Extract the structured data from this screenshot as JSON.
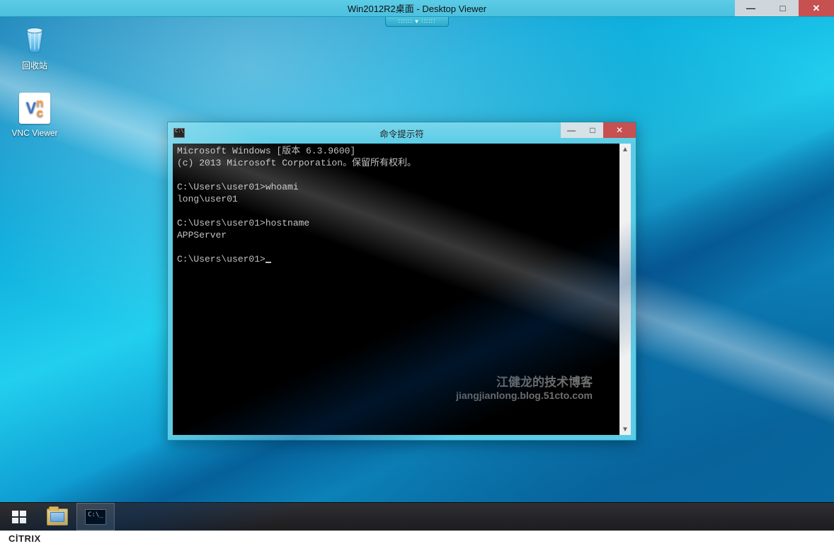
{
  "viewer": {
    "title": "Win2012R2桌面 - Desktop Viewer",
    "min_symbol": "—",
    "max_symbol": "□",
    "close_symbol": "✕"
  },
  "pull_tab": {
    "glyph": "∷∷∷ ▾ ∷∷∷"
  },
  "desktop_icons": {
    "recycle_bin_label": "回收站",
    "vnc_label": "VNC Viewer",
    "vnc_text_v": "V",
    "vnc_text_nc": "n\nc"
  },
  "cmd_window": {
    "title": "命令提示符",
    "min_symbol": "—",
    "max_symbol": "□",
    "close_symbol": "✕",
    "lines": [
      "Microsoft Windows [版本 6.3.9600]",
      "(c) 2013 Microsoft Corporation。保留所有权利。",
      "",
      "C:\\Users\\user01>whoami",
      "long\\user01",
      "",
      "C:\\Users\\user01>hostname",
      "APPServer",
      "",
      "C:\\Users\\user01>"
    ],
    "scroll_up": "▲",
    "scroll_down": "▼"
  },
  "watermark": {
    "line1": "江健龙的技术博客",
    "line2": "jiangjianlong.blog.51cto.com"
  },
  "footer": {
    "brand": "CİTRIX"
  }
}
